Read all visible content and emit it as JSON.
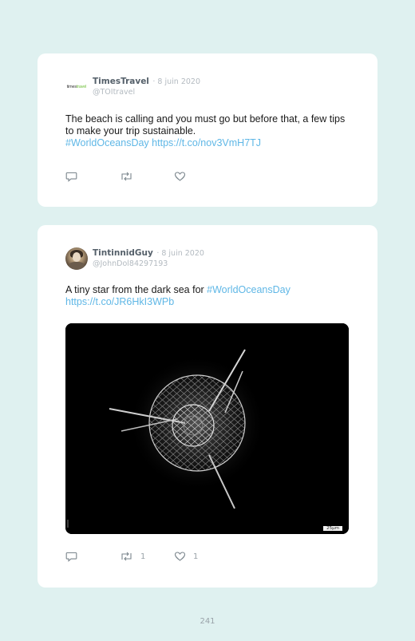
{
  "tweets": [
    {
      "avatar_icon": "timestravel-logo",
      "avatar_logo": {
        "part_a": "times",
        "part_b": "travel"
      },
      "display_name": "TimesTravel",
      "date": "· 8 juin 2020",
      "handle": "@TOItravel",
      "text_before": "The beach is calling and you must go but before that, a few tips to make your trip sustainable.",
      "hashtag": "#WorldOceansDay",
      "link": "https://t.co/nov3VmH7TJ",
      "actions": {
        "reply_count": "",
        "retweet_count": "",
        "like_count": ""
      }
    },
    {
      "avatar_icon": "user-photo",
      "display_name": "TintinnidGuy",
      "date": "· 8 juin 2020",
      "handle": "@JohnDol84297193",
      "text_before": "A tiny star from the dark sea for ",
      "hashtag": "#WorldOceansDay",
      "link": "https://t.co/JR6HkI3WPb",
      "image": {
        "description_icon": "radiolarian-microscope-image",
        "scale_label": "25µm"
      },
      "actions": {
        "reply_count": "",
        "retweet_count": "1",
        "like_count": "1"
      }
    }
  ],
  "page_number": "241",
  "colors": {
    "background": "#dff1f0",
    "card": "#ffffff",
    "link": "#5fb7e6",
    "meta": "#b3bac0",
    "name": "#55606a"
  }
}
